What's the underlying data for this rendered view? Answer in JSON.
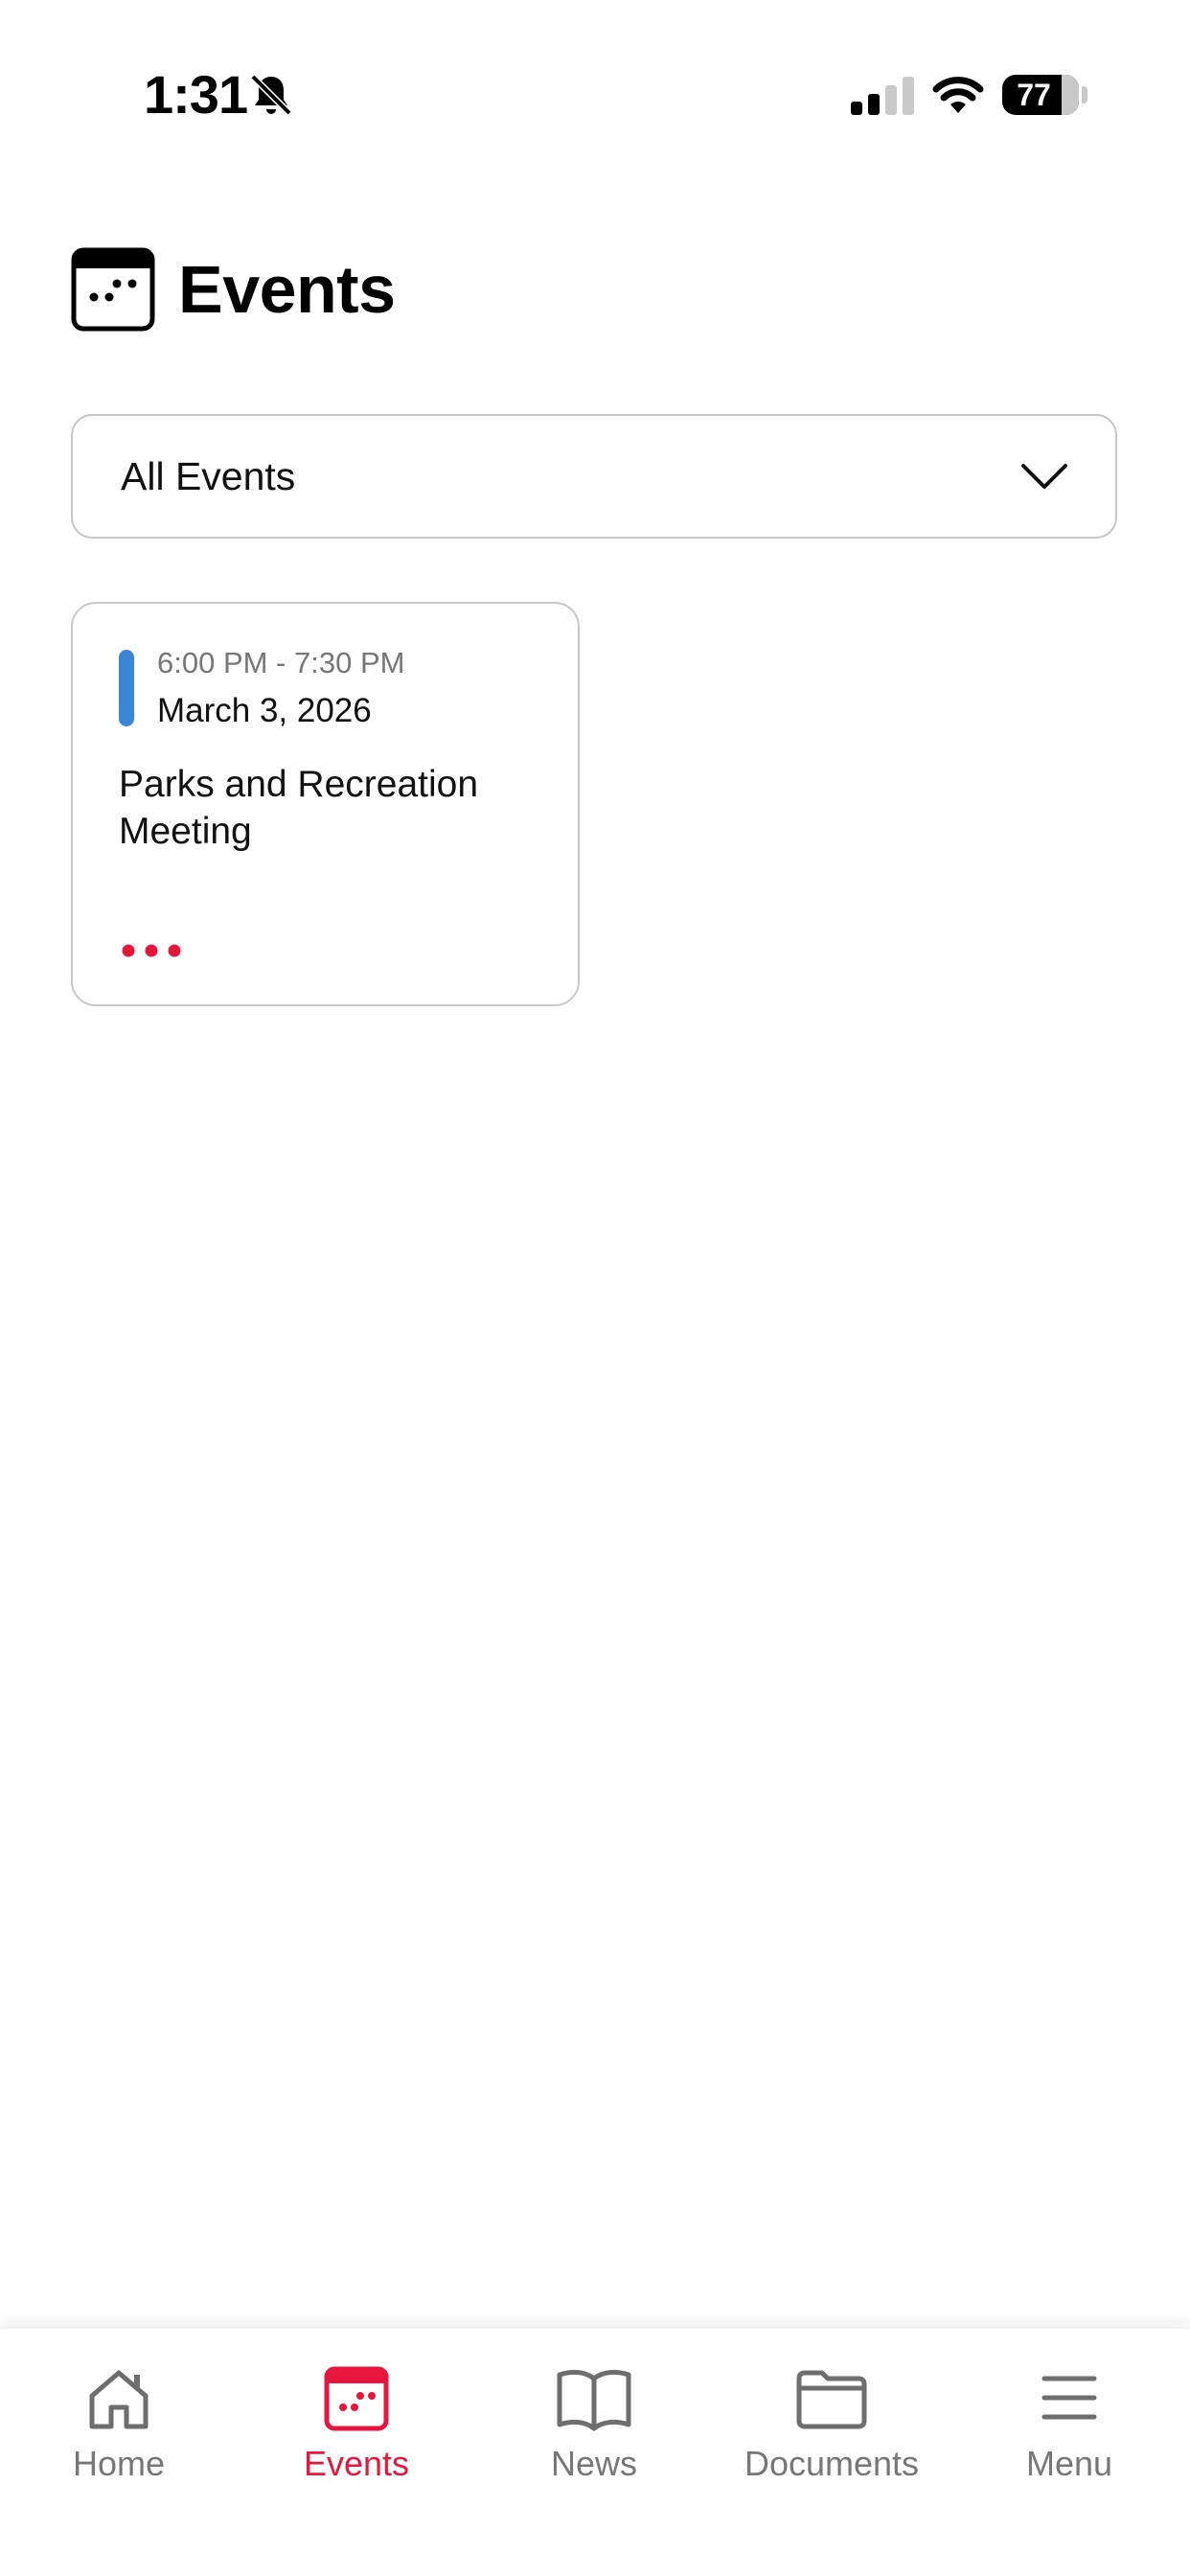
{
  "status_bar": {
    "time": "1:31",
    "battery": "77",
    "battery_level_percent": 77
  },
  "header": {
    "title": "Events",
    "icon": "calendar-icon"
  },
  "filter": {
    "selected": "All Events"
  },
  "events": [
    {
      "time": "6:00 PM - 7:30 PM",
      "date": "March 3, 2026",
      "title": "Parks and Recreation Meeting",
      "accent_color": "#3a86d4"
    }
  ],
  "tab_bar": {
    "items": [
      {
        "label": "Home",
        "icon": "home-icon",
        "active": false
      },
      {
        "label": "Events",
        "icon": "calendar-icon",
        "active": true
      },
      {
        "label": "News",
        "icon": "book-icon",
        "active": false
      },
      {
        "label": "Documents",
        "icon": "folder-icon",
        "active": false
      },
      {
        "label": "Menu",
        "icon": "menu-icon",
        "active": false
      }
    ]
  },
  "colors": {
    "accent": "#e6163f",
    "inactive": "#777777"
  }
}
